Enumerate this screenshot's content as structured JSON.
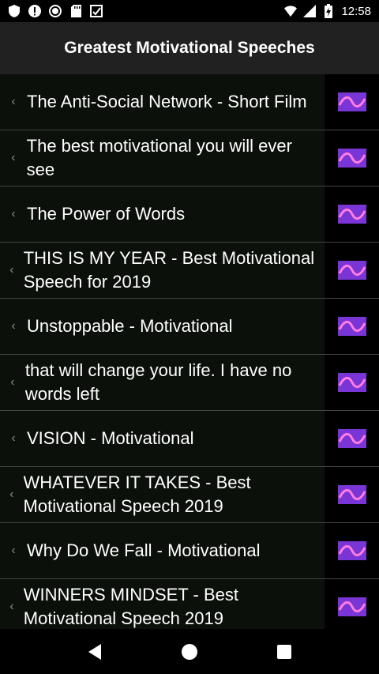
{
  "status": {
    "time": "12:58",
    "left_icons": [
      "shield-icon",
      "alert-icon",
      "circle-icon",
      "sd-card-icon",
      "cast-icon"
    ],
    "right_icons": [
      "wifi-icon",
      "signal-icon",
      "battery-charging-icon"
    ]
  },
  "app": {
    "title": "Greatest Motivational Speeches"
  },
  "list": {
    "items": [
      {
        "title": "The Anti-Social Network - Short Film"
      },
      {
        "title": "The best motivational you will ever see"
      },
      {
        "title": "The Power of Words"
      },
      {
        "title": "THIS IS MY YEAR - Best Motivational Speech for 2019"
      },
      {
        "title": "Unstoppable - Motivational"
      },
      {
        "title": "that will change your life. I have no words left"
      },
      {
        "title": "VISION - Motivational"
      },
      {
        "title": "WHATEVER IT TAKES - Best Motivational Speech 2019"
      },
      {
        "title": "Why Do We Fall - Motivational"
      },
      {
        "title": "WINNERS MINDSET - Best Motivational Speech 2019"
      }
    ]
  },
  "colors": {
    "app_bar": "#212121",
    "row_bg": "#0b100b",
    "thumb_purple": "#7a35d6",
    "thumb_wave": "#ff7de0"
  }
}
